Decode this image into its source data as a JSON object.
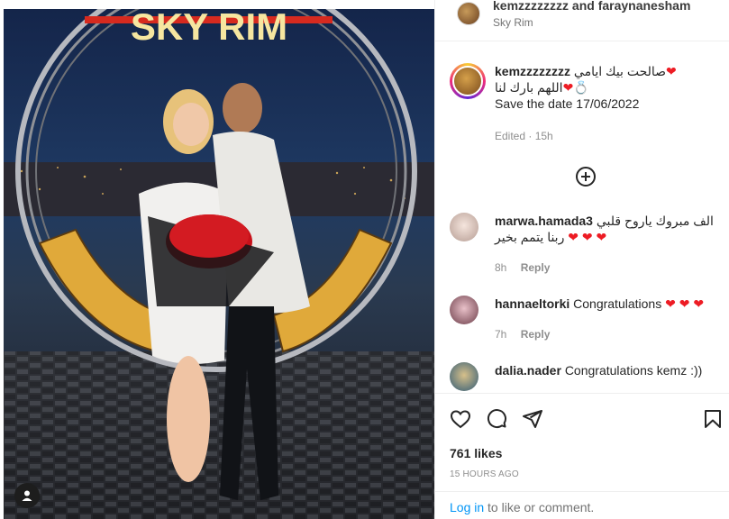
{
  "photo": {
    "sign_text": "SKY RIM",
    "tag_icon": "user-tag-icon"
  },
  "header": {
    "username": "kemzzzzzzzz and faraynanesham",
    "location": "Sky Rim"
  },
  "caption": {
    "username": "kemzzzzzzzz",
    "line1": "صالحت بيك ايامي",
    "line2": "اللهم بارك لنا",
    "line3": "Save the date 17/06/2022",
    "status": "Edited · 15h"
  },
  "load_more_icon": "plus-circle-icon",
  "comments": [
    {
      "username": "marwa.hamada3",
      "text_line1": "الف مبروك ياروح قلبي",
      "text_line2": "ربنا يتمم بخير",
      "time": "8h",
      "reply": "Reply"
    },
    {
      "username": "hannaeltorki",
      "text": "Congratulations",
      "hearts": "❤ ❤ ❤",
      "time": "7h",
      "reply": "Reply"
    },
    {
      "username": "dalia.nader",
      "text": "Congratulations kemz :))"
    }
  ],
  "actions": {
    "like_icon": "heart-icon",
    "comment_icon": "comment-icon",
    "share_icon": "send-icon",
    "save_icon": "bookmark-icon"
  },
  "likes": "761 likes",
  "timestamp": "15 HOURS AGO",
  "login": {
    "link": "Log in",
    "rest": " to like or comment."
  }
}
